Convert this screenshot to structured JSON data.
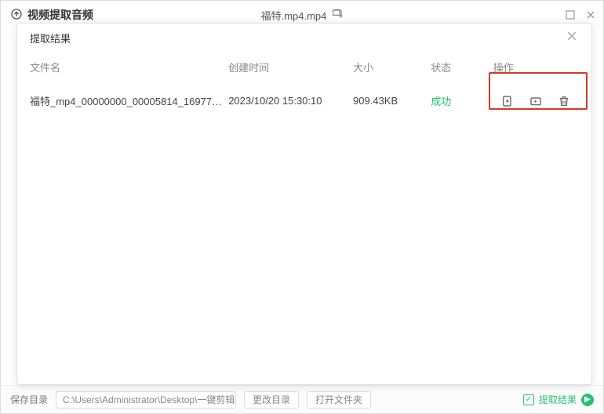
{
  "mainWindow": {
    "title": "视频提取音频",
    "currentFile": "福特.mp4.mp4"
  },
  "modal": {
    "title": "提取结果",
    "columns": {
      "name": "文件名",
      "time": "创建时间",
      "size": "大小",
      "status": "状态",
      "actions": "操作"
    },
    "rows": [
      {
        "name": "福特_mp4_00000000_00005814_1697787...",
        "time": "2023/10/20 15:30:10",
        "size": "909.43KB",
        "status": "成功"
      }
    ]
  },
  "bottomBar": {
    "savePathLabel": "保存目录",
    "savePath": "C:\\Users\\Administrator\\Desktop\\一键剪辑",
    "changeDir": "更改目录",
    "openFolder": "打开文件夹",
    "resultLabel": "提取结果"
  }
}
